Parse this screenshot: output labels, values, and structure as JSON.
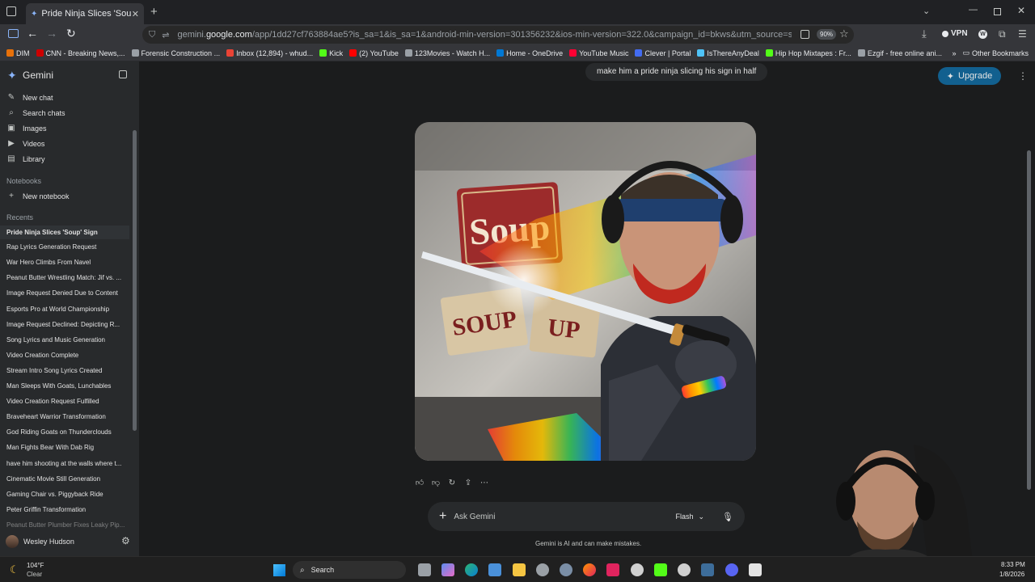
{
  "browser": {
    "tab_title": "Pride Ninja Slices 'Soup' Sign - G",
    "url_prefix": "gemini.",
    "url_host": "google.com",
    "url_rest": "/app/1dd27cf763884ae5?is_sa=1&is_sa=1&android-min-version=301356232&ios-min-version=322.0&campaign_id=bkws&utm_source=sem&utm_medium=paid-med",
    "zoom": "90%",
    "vpn_label": "VPN",
    "bookmarks": [
      {
        "label": "DIM",
        "color": "#e8710a"
      },
      {
        "label": "CNN - Breaking News,...",
        "color": "#cc0000"
      },
      {
        "label": "Forensic Construction ...",
        "color": "#9aa0a6"
      },
      {
        "label": "Inbox (12,894) - whud...",
        "color": "#ea4335"
      },
      {
        "label": "Kick",
        "color": "#53fc18"
      },
      {
        "label": "(2) YouTube",
        "color": "#ff0000"
      },
      {
        "label": "123Movies - Watch H...",
        "color": "#9aa0a6"
      },
      {
        "label": "Home - OneDrive",
        "color": "#0078d4"
      },
      {
        "label": "YouTube Music",
        "color": "#ff0033"
      },
      {
        "label": "Clever | Portal",
        "color": "#436cf2"
      },
      {
        "label": "IsThereAnyDeal",
        "color": "#4fc3f7"
      },
      {
        "label": "Hip Hop Mixtapes : Fr...",
        "color": "#53fc18"
      },
      {
        "label": "Ezgif - free online ani...",
        "color": "#9aa0a6"
      }
    ],
    "other_bookmarks": "Other Bookmarks"
  },
  "sidebar": {
    "title": "Gemini",
    "nav": [
      {
        "label": "New chat",
        "icon": "edit-icon"
      },
      {
        "label": "Search chats",
        "icon": "search-icon"
      },
      {
        "label": "Images",
        "icon": "image-icon"
      },
      {
        "label": "Videos",
        "icon": "video-icon"
      },
      {
        "label": "Library",
        "icon": "library-icon"
      }
    ],
    "notebooks_heading": "Notebooks",
    "new_notebook": "New notebook",
    "recents_heading": "Recents",
    "recents": [
      "Pride Ninja Slices 'Soup' Sign",
      "Rap Lyrics Generation Request",
      "War Hero Climbs From Navel",
      "Peanut Butter Wrestling Match: Jif vs. ...",
      "Image Request Denied Due to Content",
      "Esports Pro at World Championship",
      "Image Request Declined: Depicting R...",
      "Song Lyrics and Music Generation",
      "Video Creation Complete",
      "Stream Intro Song Lyrics Created",
      "Man Sleeps With Goats, Lunchables",
      "Video Creation Request Fulfilled",
      "Braveheart Warrior Transformation",
      "God Riding Goats on Thunderclouds",
      "Man Fights Bear With Dab Rig",
      "have him shooting at the walls where t...",
      "Cinematic Movie Still Generation",
      "Gaming Chair vs. Piggyback Ride",
      "Peter Griffin Transformation",
      "Peanut Butter Plumber Fixes Leaky Pip..."
    ],
    "user_name": "Wesley Hudson"
  },
  "main": {
    "user_prompt": "make him a pride ninja slicing his sign in half",
    "upgrade_label": "Upgrade",
    "image_sign_top": "Soup",
    "image_sign_left": "SOUP",
    "image_sign_right": "UP",
    "ask_placeholder": "Ask Gemini",
    "model_label": "Flash",
    "disclaimer": "Gemini is AI and can make mistakes."
  },
  "taskbar": {
    "weather_temp": "104°F",
    "weather_desc": "Clear",
    "search_label": "Search",
    "time": "8:33 PM",
    "date": "1/8/2026"
  }
}
